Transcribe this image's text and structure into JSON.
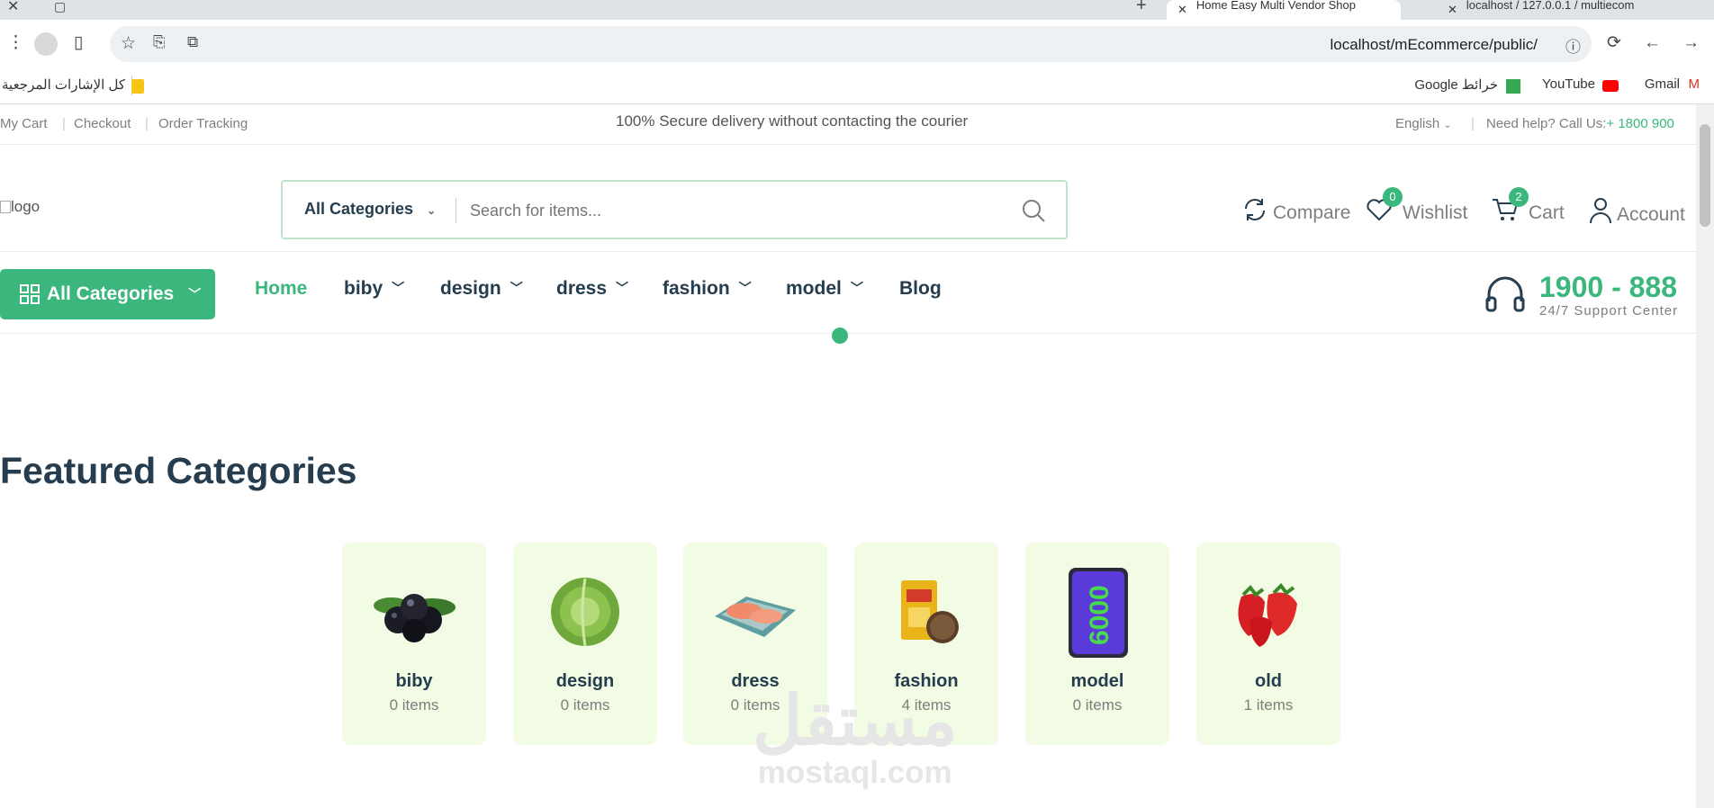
{
  "browser": {
    "tabs": [
      {
        "title": "Home Easy Multi Vendor Shop",
        "active": true
      },
      {
        "title": "localhost / 127.0.0.1 / multiecom",
        "active": false
      }
    ],
    "url": "localhost/mEcommerce/public/",
    "bookmarks": {
      "left": [
        {
          "label": "Gmail",
          "icon": "gmail-icon"
        },
        {
          "label": "YouTube",
          "icon": "youtube-icon"
        },
        {
          "label": "خرائط Google",
          "icon": "maps-icon"
        }
      ],
      "all_label": "كل الإشارات المرجعية"
    }
  },
  "topbar": {
    "links": [
      "My Cart",
      "Checkout",
      "Order Tracking"
    ],
    "promo": "100% Secure delivery without contacting the courier",
    "language": "English",
    "help_label": "Need help? Call Us:",
    "help_phone": "+ 1800 900"
  },
  "header": {
    "logo_alt": "logo",
    "search": {
      "category": "All Categories",
      "placeholder": "Search for items..."
    },
    "actions": {
      "compare": "Compare",
      "wishlist": "Wishlist",
      "wishlist_count": "0",
      "cart": "Cart",
      "cart_count": "2",
      "account": "Account"
    }
  },
  "nav": {
    "all_categories": "All Categories",
    "menu": [
      {
        "label": "Home",
        "active": true,
        "dropdown": false
      },
      {
        "label": "biby",
        "dropdown": true
      },
      {
        "label": "design",
        "dropdown": true
      },
      {
        "label": "dress",
        "dropdown": true
      },
      {
        "label": "fashion",
        "dropdown": true
      },
      {
        "label": "model",
        "dropdown": true
      },
      {
        "label": "Blog",
        "dropdown": false
      }
    ],
    "support_number": "1900 - 888",
    "support_text": "24/7 Support Center"
  },
  "featured": {
    "title": "Featured Categories",
    "categories": [
      {
        "name": "biby",
        "count": "0 items",
        "image": "blackberries"
      },
      {
        "name": "design",
        "count": "0 items",
        "image": "cabbage"
      },
      {
        "name": "dress",
        "count": "0 items",
        "image": "salmon"
      },
      {
        "name": "fashion",
        "count": "4 items",
        "image": "spice-packet"
      },
      {
        "name": "model",
        "count": "0 items",
        "image": "phone-6000"
      },
      {
        "name": "old",
        "count": "1 items",
        "image": "strawberries"
      }
    ]
  },
  "watermark": {
    "arabic": "مستقل",
    "latin": "mostaql.com"
  },
  "colors": {
    "brand": "#3bb77e",
    "heading": "#253d4e",
    "card_bg": "#f2fce4"
  }
}
